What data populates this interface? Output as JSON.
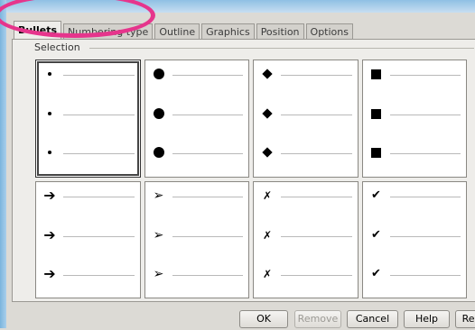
{
  "tabs": [
    "Bullets",
    "Numbering type",
    "Outline",
    "Graphics",
    "Position",
    "Options"
  ],
  "active_tab": "Bullets",
  "section": {
    "legend": "Selection"
  },
  "buttons": {
    "ok": "OK",
    "remove": "Remove",
    "cancel": "Cancel",
    "help": "Help",
    "reset": "Reset"
  },
  "bullet_styles": [
    {
      "icon": "small-dot-bullet-icon",
      "glyph": "•"
    },
    {
      "icon": "large-dot-bullet-icon",
      "glyph": "●"
    },
    {
      "icon": "diamond-bullet-icon",
      "glyph": "◆"
    },
    {
      "icon": "square-bullet-icon",
      "glyph": "■"
    },
    {
      "icon": "arrow-bullet-icon",
      "glyph": "➔"
    },
    {
      "icon": "arrowhead-bullet-icon",
      "glyph": "➢"
    },
    {
      "icon": "cross-bullet-icon",
      "glyph": "✗"
    },
    {
      "icon": "check-bullet-icon",
      "glyph": "✔"
    }
  ],
  "selected_style_index": 0,
  "highlight_color": "#e6358c"
}
